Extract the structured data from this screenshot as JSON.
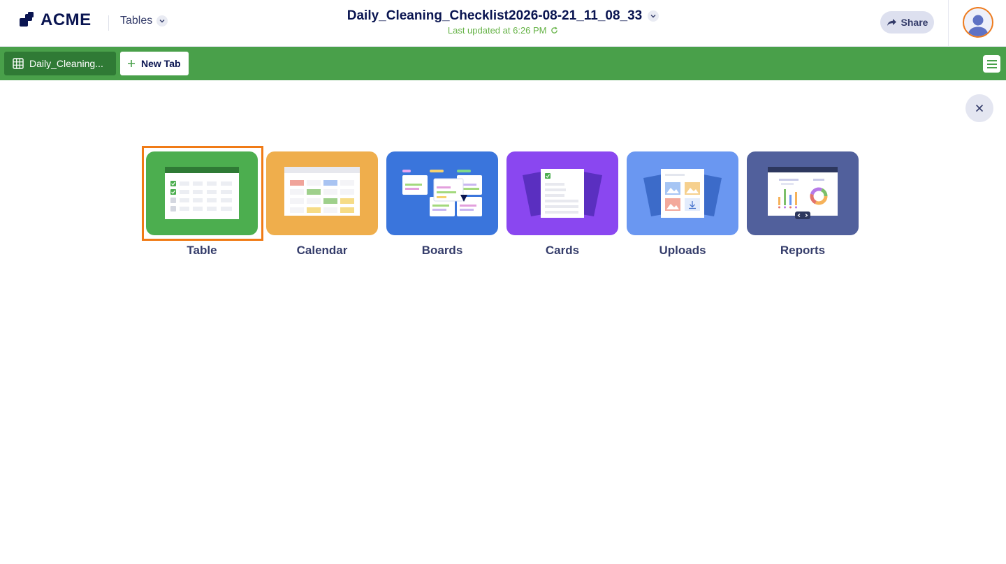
{
  "header": {
    "logo_text": "ACME",
    "app_switch_label": "Tables",
    "doc_title": "Daily_Cleaning_Checklist2026-08-21_11_08_33",
    "last_updated": "Last updated at 6:26 PM",
    "share_label": "Share"
  },
  "tabs": {
    "active_label": "Daily_Cleaning...",
    "new_tab_label": "New Tab"
  },
  "views": [
    {
      "label": "Table",
      "color": "#4cae4f",
      "selected": true
    },
    {
      "label": "Calendar",
      "color": "#efae4c"
    },
    {
      "label": "Boards",
      "color": "#3a75dc"
    },
    {
      "label": "Cards",
      "color": "#8a47f0"
    },
    {
      "label": "Uploads",
      "color": "#6a97f1"
    },
    {
      "label": "Reports",
      "color": "#51609c"
    }
  ],
  "colors": {
    "brand": "#0a1551",
    "tabbar": "#49a04a",
    "tab_active": "#2f7a35",
    "selection": "#f07b16",
    "updated_text": "#64b245"
  }
}
